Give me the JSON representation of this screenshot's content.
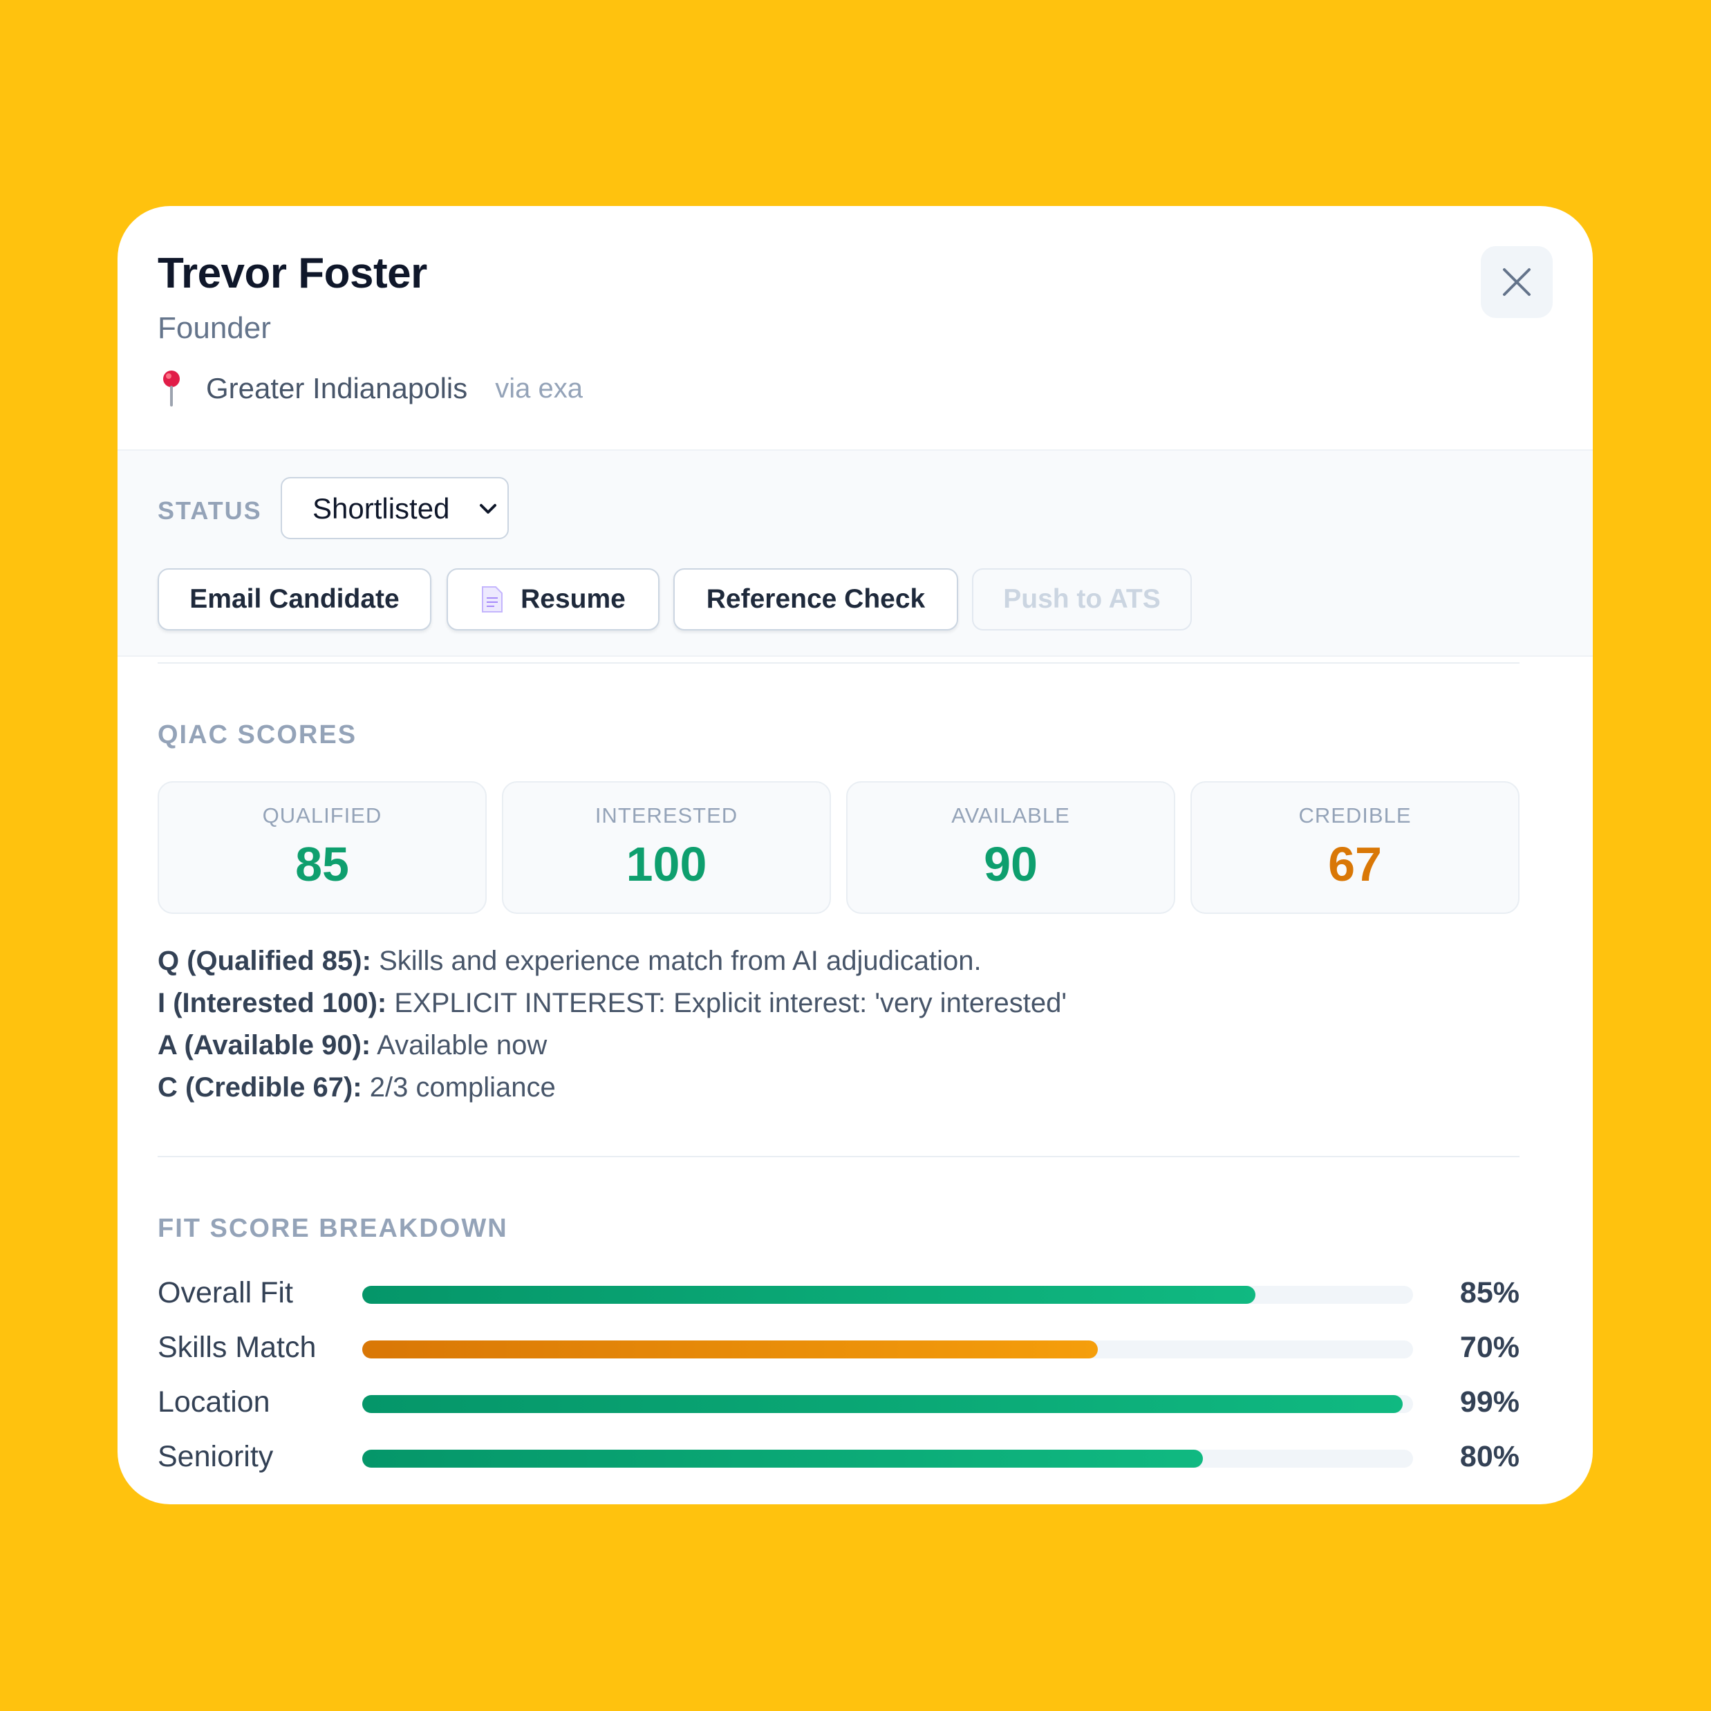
{
  "candidate": {
    "name": "Trevor Foster",
    "role": "Founder",
    "location": "Greater Indianapolis",
    "source": "via exa"
  },
  "status": {
    "label": "STATUS",
    "selected": "Shortlisted"
  },
  "actions": {
    "email": "Email Candidate",
    "resume": "Resume",
    "reference": "Reference Check",
    "push_ats": "Push to ATS"
  },
  "qiac": {
    "title": "QIAC SCORES",
    "scores": [
      {
        "label": "QUALIFIED",
        "value": "85",
        "color": "#0E9F6E"
      },
      {
        "label": "INTERESTED",
        "value": "100",
        "color": "#0E9F6E"
      },
      {
        "label": "AVAILABLE",
        "value": "90",
        "color": "#0E9F6E"
      },
      {
        "label": "CREDIBLE",
        "value": "67",
        "color": "#D97706"
      }
    ],
    "explanations": [
      {
        "key": "Q (Qualified 85):",
        "text": "Skills and experience match from AI adjudication."
      },
      {
        "key": "I (Interested 100):",
        "text": "EXPLICIT INTEREST: Explicit interest: 'very interested'"
      },
      {
        "key": "A (Available 90):",
        "text": "Available now"
      },
      {
        "key": "C (Credible 67):",
        "text": "2/3 compliance"
      }
    ]
  },
  "fit": {
    "title": "FIT SCORE BREAKDOWN",
    "rows": [
      {
        "label": "Overall Fit",
        "value": 85,
        "pct": "85%",
        "color": "green"
      },
      {
        "label": "Skills Match",
        "value": 70,
        "pct": "70%",
        "color": "orange"
      },
      {
        "label": "Location",
        "value": 99,
        "pct": "99%",
        "color": "green"
      },
      {
        "label": "Seniority",
        "value": 80,
        "pct": "80%",
        "color": "green"
      }
    ]
  },
  "colors": {
    "background": "#FFC20E",
    "green_start": "#059669",
    "green_end": "#10B981",
    "orange_start": "#D97706",
    "orange_end": "#F59E0B"
  },
  "icons": {
    "pin": "map-pin-icon",
    "close": "close-icon",
    "resume": "document-icon",
    "select": "chevron-down-icon"
  }
}
